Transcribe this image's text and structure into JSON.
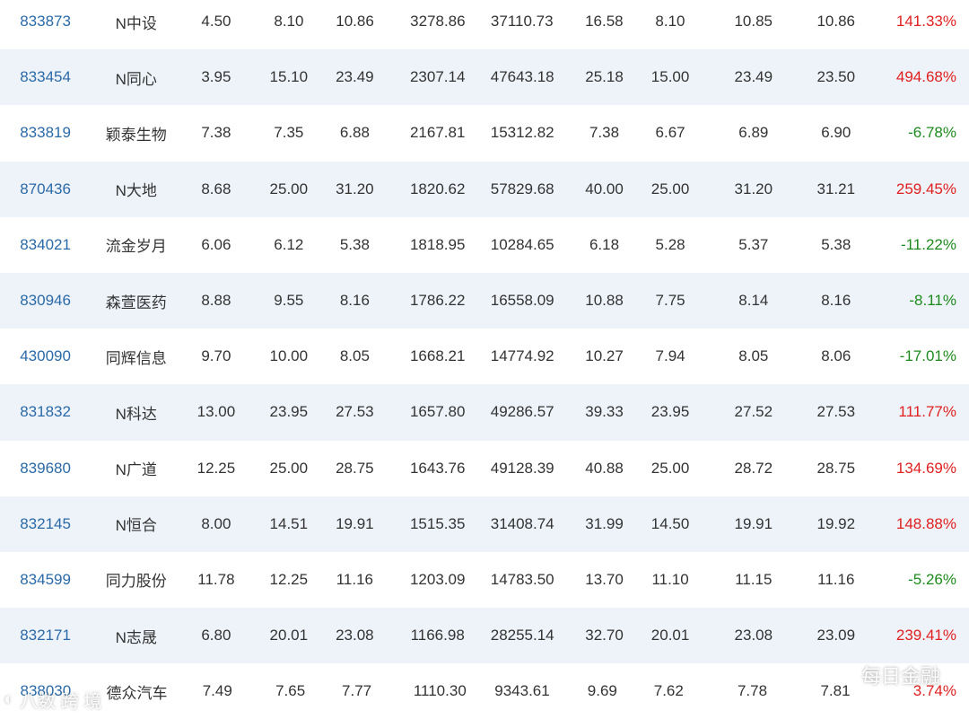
{
  "columns": [
    "code",
    "name",
    "open",
    "prev_close",
    "latest",
    "volume",
    "amount",
    "high",
    "low",
    "bid",
    "ask",
    "change_pct"
  ],
  "rows": [
    {
      "code": "833873",
      "name": "N中设",
      "open": "4.50",
      "prev_close": "8.10",
      "latest": "10.86",
      "volume": "3278.86",
      "amount": "37110.73",
      "high": "16.58",
      "low": "8.10",
      "bid": "10.85",
      "ask": "10.86",
      "change_pct": "141.33%",
      "dir": "pos"
    },
    {
      "code": "833454",
      "name": "N同心",
      "open": "3.95",
      "prev_close": "15.10",
      "latest": "23.49",
      "volume": "2307.14",
      "amount": "47643.18",
      "high": "25.18",
      "low": "15.00",
      "bid": "23.49",
      "ask": "23.50",
      "change_pct": "494.68%",
      "dir": "pos"
    },
    {
      "code": "833819",
      "name": "颖泰生物",
      "open": "7.38",
      "prev_close": "7.35",
      "latest": "6.88",
      "volume": "2167.81",
      "amount": "15312.82",
      "high": "7.38",
      "low": "6.67",
      "bid": "6.89",
      "ask": "6.90",
      "change_pct": "-6.78%",
      "dir": "neg"
    },
    {
      "code": "870436",
      "name": "N大地",
      "open": "8.68",
      "prev_close": "25.00",
      "latest": "31.20",
      "volume": "1820.62",
      "amount": "57829.68",
      "high": "40.00",
      "low": "25.00",
      "bid": "31.20",
      "ask": "31.21",
      "change_pct": "259.45%",
      "dir": "pos"
    },
    {
      "code": "834021",
      "name": "流金岁月",
      "open": "6.06",
      "prev_close": "6.12",
      "latest": "5.38",
      "volume": "1818.95",
      "amount": "10284.65",
      "high": "6.18",
      "low": "5.28",
      "bid": "5.37",
      "ask": "5.38",
      "change_pct": "-11.22%",
      "dir": "neg"
    },
    {
      "code": "830946",
      "name": "森萱医药",
      "open": "8.88",
      "prev_close": "9.55",
      "latest": "8.16",
      "volume": "1786.22",
      "amount": "16558.09",
      "high": "10.88",
      "low": "7.75",
      "bid": "8.14",
      "ask": "8.16",
      "change_pct": "-8.11%",
      "dir": "neg"
    },
    {
      "code": "430090",
      "name": "同辉信息",
      "open": "9.70",
      "prev_close": "10.00",
      "latest": "8.05",
      "volume": "1668.21",
      "amount": "14774.92",
      "high": "10.27",
      "low": "7.94",
      "bid": "8.05",
      "ask": "8.06",
      "change_pct": "-17.01%",
      "dir": "neg"
    },
    {
      "code": "831832",
      "name": "N科达",
      "open": "13.00",
      "prev_close": "23.95",
      "latest": "27.53",
      "volume": "1657.80",
      "amount": "49286.57",
      "high": "39.33",
      "low": "23.95",
      "bid": "27.52",
      "ask": "27.53",
      "change_pct": "111.77%",
      "dir": "pos"
    },
    {
      "code": "839680",
      "name": "N广道",
      "open": "12.25",
      "prev_close": "25.00",
      "latest": "28.75",
      "volume": "1643.76",
      "amount": "49128.39",
      "high": "40.88",
      "low": "25.00",
      "bid": "28.72",
      "ask": "28.75",
      "change_pct": "134.69%",
      "dir": "pos"
    },
    {
      "code": "832145",
      "name": "N恒合",
      "open": "8.00",
      "prev_close": "14.51",
      "latest": "19.91",
      "volume": "1515.35",
      "amount": "31408.74",
      "high": "31.99",
      "low": "14.50",
      "bid": "19.91",
      "ask": "19.92",
      "change_pct": "148.88%",
      "dir": "pos"
    },
    {
      "code": "834599",
      "name": "同力股份",
      "open": "11.78",
      "prev_close": "12.25",
      "latest": "11.16",
      "volume": "1203.09",
      "amount": "14783.50",
      "high": "13.70",
      "low": "11.10",
      "bid": "11.15",
      "ask": "11.16",
      "change_pct": "-5.26%",
      "dir": "neg"
    },
    {
      "code": "832171",
      "name": "N志晟",
      "open": "6.80",
      "prev_close": "20.01",
      "latest": "23.08",
      "volume": "1166.98",
      "amount": "28255.14",
      "high": "32.70",
      "low": "20.01",
      "bid": "23.08",
      "ask": "23.09",
      "change_pct": "239.41%",
      "dir": "pos"
    },
    {
      "code": "838030",
      "name": "德众汽车",
      "open": "7.49",
      "prev_close": "7.65",
      "latest": "7.77",
      "volume": "1110.30",
      "amount": "9343.61",
      "high": "9.69",
      "low": "7.62",
      "bid": "7.78",
      "ask": "7.81",
      "change_pct": "3.74%",
      "dir": "pos"
    }
  ],
  "watermarks": {
    "left": "八数 跨 境",
    "right": "每日金融"
  },
  "colors": {
    "code": "#2b6aa8",
    "positive": "#e02020",
    "negative": "#1d8a1d",
    "alt_row": "#eef3f9"
  }
}
